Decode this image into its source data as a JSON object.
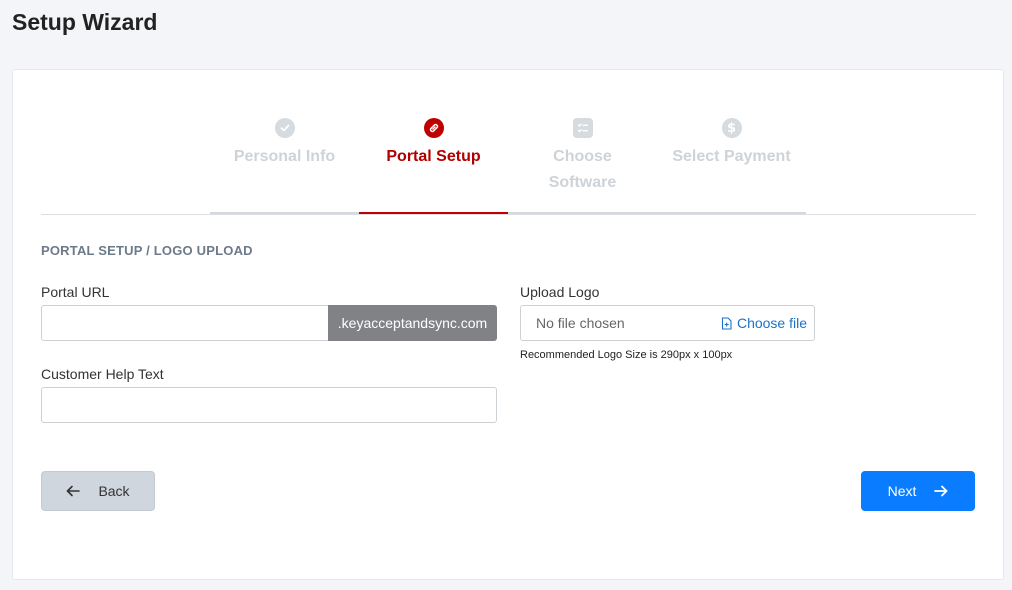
{
  "page": {
    "title": "Setup Wizard"
  },
  "stepper": {
    "steps": [
      {
        "label": "Personal Info",
        "icon": "check-circle-icon",
        "state": "completed"
      },
      {
        "label": "Portal Setup",
        "icon": "link-icon",
        "state": "active"
      },
      {
        "label": "Choose Software",
        "icon": "checklist-icon",
        "state": "pending"
      },
      {
        "label": "Select Payment",
        "icon": "dollar-icon",
        "state": "pending"
      }
    ],
    "active_color": "#c00000",
    "inactive_color": "#d6dbe0"
  },
  "section": {
    "title": "PORTAL SETUP / LOGO UPLOAD"
  },
  "form": {
    "portal_url": {
      "label": "Portal URL",
      "value": "",
      "suffix": ".keyacceptandsync.com"
    },
    "help_text": {
      "label": "Customer Help Text",
      "value": ""
    },
    "upload_logo": {
      "label": "Upload Logo",
      "status": "No file chosen",
      "button": "Choose file",
      "hint": "Recommended Logo Size is 290px x 100px"
    }
  },
  "actions": {
    "back_label": "Back",
    "next_label": "Next",
    "next_color": "#0a7cff"
  }
}
